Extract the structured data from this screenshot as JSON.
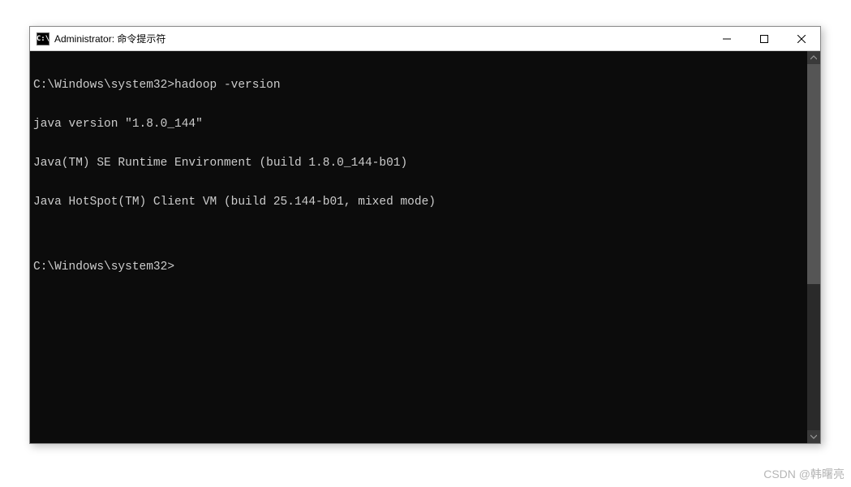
{
  "window": {
    "title": "Administrator: 命令提示符",
    "icon_label": "C:\\"
  },
  "terminal": {
    "lines": [
      "C:\\Windows\\system32>hadoop -version",
      "java version \"1.8.0_144\"",
      "Java(TM) SE Runtime Environment (build 1.8.0_144-b01)",
      "Java HotSpot(TM) Client VM (build 25.144-b01, mixed mode)",
      "",
      "C:\\Windows\\system32>"
    ]
  },
  "watermark": "CSDN @韩曙亮"
}
